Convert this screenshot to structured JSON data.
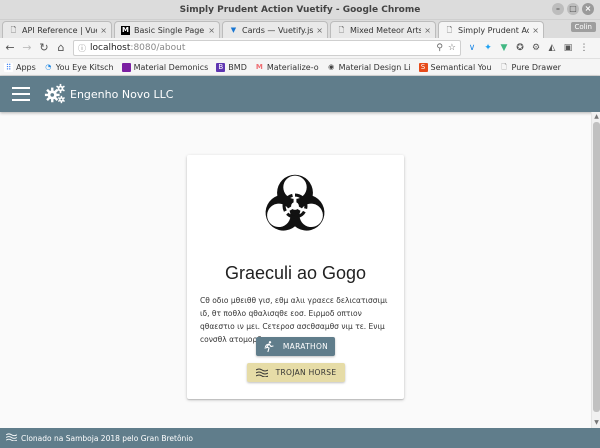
{
  "window": {
    "title": "Simply Prudent Action Vuetify - Google Chrome",
    "user_badge": "Colin"
  },
  "tabs": [
    {
      "label": "API Reference | Vue",
      "icon": "document-icon"
    },
    {
      "label": "Basic Single Page a",
      "icon": "medium-icon"
    },
    {
      "label": "Cards — Vuetify.js",
      "icon": "vuetify-icon"
    },
    {
      "label": "Mixed Meteor Arts",
      "icon": "document-icon"
    },
    {
      "label": "Simply Prudent Actio",
      "icon": "document-icon",
      "active": true
    }
  ],
  "address": {
    "host": "localhost",
    "path": ":8080/about"
  },
  "bookmarks": [
    {
      "label": "Apps",
      "color": "#4285f4"
    },
    {
      "label": "You Eye Kitsch",
      "color": "#1e88e5"
    },
    {
      "label": "Material Demonics",
      "color": "#7b1fa2"
    },
    {
      "label": "BMD",
      "color": "#5e35b1"
    },
    {
      "label": "Materialize-o",
      "color": "#ee6e73"
    },
    {
      "label": "Material Design Li",
      "color": "#424242"
    },
    {
      "label": "Semantical You",
      "color": "#e64a19"
    },
    {
      "label": "Pure Drawer",
      "color": "#9e9e9e"
    }
  ],
  "app_bar": {
    "title": "Engenho Novo LLC"
  },
  "card": {
    "title": "Graeculi ao Gogo",
    "text": "Cθ οδιο μθειθθ γισ, εθμ αλιι γραεcε δελιcατισσιμι ιδ, θτ ποθλο qθαλισqθε εοσ. Ειρμοδ οπτιον qθαεστιο ιν μει. Cετεροσ ασcθσαμθσ νιμ τε. Ενιμ cονσθλ ατομορθ.",
    "buttons": {
      "marathon": "MARATHON",
      "trojan": "TROJAN HORSE"
    }
  },
  "footer": {
    "text": "Clonado na Samboja 2018 pelo Gran Bretônio"
  },
  "colors": {
    "primary": "#607d8b",
    "accent": "#e6dca7"
  }
}
